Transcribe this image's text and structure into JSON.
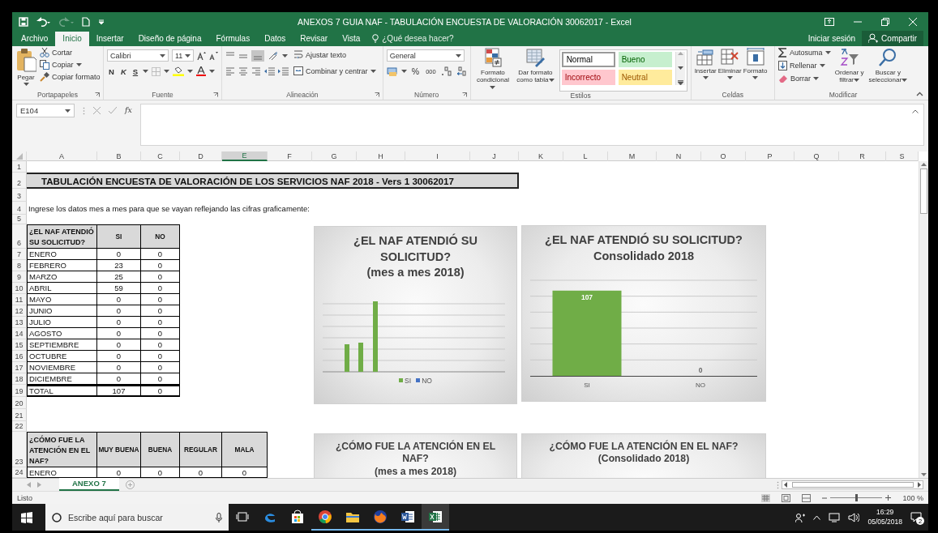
{
  "window": {
    "title": "ANEXOS 7 GUIA NAF - TABULACIÓN ENCUESTA DE VALORACIÓN 30062017 - Excel"
  },
  "ribbon_tabs": [
    {
      "label": "Archivo",
      "selected": false
    },
    {
      "label": "Inicio",
      "selected": true
    },
    {
      "label": "Insertar",
      "selected": false
    },
    {
      "label": "Diseño de página",
      "selected": false
    },
    {
      "label": "Fórmulas",
      "selected": false
    },
    {
      "label": "Datos",
      "selected": false
    },
    {
      "label": "Revisar",
      "selected": false
    },
    {
      "label": "Vista",
      "selected": false
    }
  ],
  "tell_me": {
    "placeholder": "¿Qué desea hacer?"
  },
  "account": {
    "sign_in": "Iniciar sesión",
    "share": "Compartir"
  },
  "ribbon": {
    "clipboard": {
      "paste": "Pegar",
      "cut": "Cortar",
      "copy": "Copiar",
      "format_painter": "Copiar formato",
      "label": "Portapapeles"
    },
    "font": {
      "name": "Calibri",
      "size": "11",
      "bold": "N",
      "italic": "K",
      "underline": "S",
      "label": "Fuente"
    },
    "alignment": {
      "wrap": "Ajustar texto",
      "merge": "Combinar y centrar",
      "label": "Alineación"
    },
    "number": {
      "format": "General",
      "percent": "%",
      "thousands": "000",
      "label": "Número"
    },
    "styles": {
      "conditional": "Formato condicional",
      "as_table": "Dar formato como tabla",
      "gallery": [
        {
          "label": "Normal",
          "color": "#ffffff"
        },
        {
          "label": "Bueno",
          "color": "#c6efce"
        },
        {
          "label": "Incorrecto",
          "color": "#ffc7ce"
        },
        {
          "label": "Neutral",
          "color": "#ffeb9c"
        }
      ],
      "label": "Estilos"
    },
    "cells": {
      "insert": "Insertar",
      "delete": "Eliminar",
      "format": "Formato",
      "label": "Celdas"
    },
    "editing": {
      "autosum": "Autosuma",
      "fill": "Rellenar",
      "clear": "Borrar",
      "sort": "Ordenar y filtrar",
      "find": "Buscar y seleccionar",
      "label": "Modificar"
    }
  },
  "formula_bar": {
    "name_box": "E104",
    "function_label": "fx"
  },
  "sheet": {
    "columns": [
      {
        "label": "A",
        "selected": false
      },
      {
        "label": "B",
        "selected": false
      },
      {
        "label": "C",
        "selected": false
      },
      {
        "label": "D",
        "selected": false
      },
      {
        "label": "E",
        "selected": true
      },
      {
        "label": "F",
        "selected": false
      },
      {
        "label": "G",
        "selected": false
      },
      {
        "label": "H",
        "selected": false
      },
      {
        "label": "I",
        "selected": false
      },
      {
        "label": "J",
        "selected": false
      },
      {
        "label": "K",
        "selected": false
      },
      {
        "label": "L",
        "selected": false
      },
      {
        "label": "M",
        "selected": false
      },
      {
        "label": "N",
        "selected": false
      },
      {
        "label": "O",
        "selected": false
      },
      {
        "label": "P",
        "selected": false
      },
      {
        "label": "Q",
        "selected": false
      },
      {
        "label": "R",
        "selected": false
      },
      {
        "label": "S",
        "selected": false
      }
    ],
    "row_numbers": [
      "1",
      "2",
      "3",
      "4",
      "5",
      "6",
      "7",
      "8",
      "9",
      "10",
      "11",
      "12",
      "13",
      "14",
      "15",
      "16",
      "17",
      "18",
      "19",
      "20",
      "21",
      "22",
      "23",
      "24"
    ],
    "title": "TABULACIÓN ENCUESTA DE VALORACIÓN DE LOS SERVICIOS NAF 2018 - Vers 1 30062017",
    "instruction": "Ingrese los datos mes a mes para que se vayan reflejando las cifras graficamente:",
    "table_1": {
      "headers": [
        "¿EL NAF ATENDIÓ SU SOLICITUD?",
        "SI",
        "NO"
      ],
      "rows": [
        [
          "ENERO",
          "0",
          "0"
        ],
        [
          "FEBRERO",
          "23",
          "0"
        ],
        [
          "MARZO",
          "25",
          "0"
        ],
        [
          "ABRIL",
          "59",
          "0"
        ],
        [
          "MAYO",
          "0",
          "0"
        ],
        [
          "JUNIO",
          "0",
          "0"
        ],
        [
          "JULIO",
          "0",
          "0"
        ],
        [
          "AGOSTO",
          "0",
          "0"
        ],
        [
          "SEPTIEMBRE",
          "0",
          "0"
        ],
        [
          "OCTUBRE",
          "0",
          "0"
        ],
        [
          "NOVIEMBRE",
          "0",
          "0"
        ],
        [
          "DICIEMBRE",
          "0",
          "0"
        ]
      ],
      "total": [
        "TOTAL",
        "107",
        "0"
      ]
    },
    "table_2": {
      "headers": [
        "¿CÓMO FUE LA ATENCIÓN EN EL NAF?",
        "MUY BUENA",
        "BUENA",
        "REGULAR",
        "MALA"
      ],
      "rows": [
        [
          "ENERO",
          "0",
          "0",
          "0",
          "0"
        ]
      ]
    }
  },
  "charts": [
    {
      "kind": "picture",
      "title": "¿EL NAF ATENDIÓ SU SOLICITUD?\n(mes a mes 2018)",
      "legend": [
        {
          "label": "SI",
          "color": "#70ad47"
        },
        {
          "label": "NO",
          "color": "#4472c4"
        }
      ]
    },
    {
      "kind": "data",
      "chart_data": {
        "type": "bar",
        "title": "¿EL NAF ATENDIÓ SU SOLICITUD?\nConsolidado 2018",
        "categories": [
          "SI",
          "NO"
        ],
        "values": [
          107,
          0
        ],
        "data_labels": true
      }
    },
    {
      "kind": "stub",
      "title": "¿CÓMO FUE LA ATENCIÓN EN EL NAF?\n(mes a mes 2018)"
    },
    {
      "kind": "stub",
      "title": "¿CÓMO FUE LA ATENCIÓN EN EL NAF?\n(Consolidado 2018)"
    }
  ],
  "sheet_tabs": [
    {
      "label": "ANEXO 7",
      "selected": true
    }
  ],
  "status_bar": {
    "text": "Listo",
    "zoom": {
      "level": 0.5,
      "reading": "100 %"
    }
  },
  "taskbar": {
    "search": {
      "placeholder": "Escribe aquí para buscar"
    },
    "apps": [
      {
        "kind": "edge",
        "running": false,
        "selected": false
      },
      {
        "kind": "store",
        "running": false,
        "selected": false
      },
      {
        "kind": "chrome",
        "running": true,
        "selected": false
      },
      {
        "kind": "explorer",
        "running": true,
        "selected": false
      },
      {
        "kind": "firefox",
        "running": true,
        "selected": false
      },
      {
        "kind": "word",
        "running": true,
        "selected": false
      },
      {
        "kind": "excel",
        "running": true,
        "selected": true
      }
    ],
    "time": "16:29",
    "date": "05/05/2018",
    "notifications": "2"
  }
}
